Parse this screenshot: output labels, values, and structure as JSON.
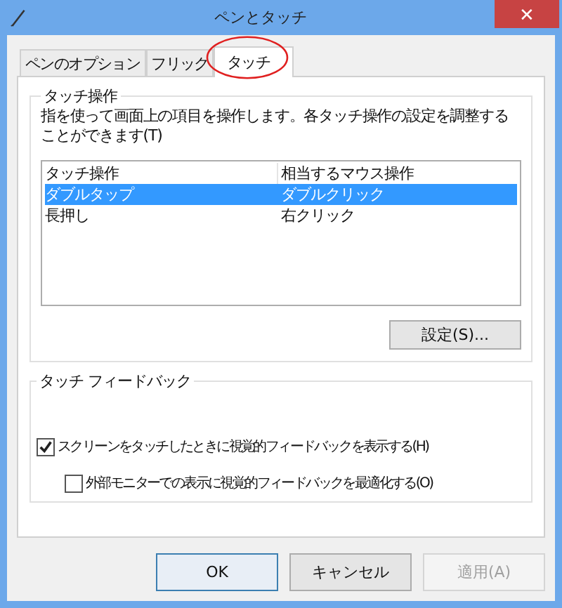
{
  "window": {
    "title": "ペンとタッチ",
    "close": "✕"
  },
  "tabs": [
    {
      "label": "ペンのオプション",
      "selected": false,
      "circled": false
    },
    {
      "label": "フリック",
      "selected": false,
      "circled": false
    },
    {
      "label": "タッチ",
      "selected": true,
      "circled": true
    }
  ],
  "touch_actions": {
    "title": "タッチ操作",
    "description": "指を使って画面上の項目を操作します。各タッチ操作の設定を調整することができます(T)",
    "columns": [
      "タッチ操作",
      "相当するマウス操作"
    ],
    "rows": [
      {
        "cells": [
          "ダブルタップ",
          "ダブルクリック"
        ],
        "selected": true
      },
      {
        "cells": [
          "長押し",
          "右クリック"
        ],
        "selected": false
      }
    ],
    "settings_button": "設定(S)..."
  },
  "touch_feedback": {
    "title": "タッチ フィードバック",
    "options": [
      {
        "label": "スクリーンをタッチしたときに視覚的フィードバックを表示する(H)",
        "checked": true,
        "children": [
          {
            "label": "外部モニターでの表示に視覚的フィードバックを最適化する(O)",
            "checked": false
          }
        ]
      }
    ]
  },
  "buttons": [
    {
      "label": "OK",
      "default": true,
      "disabled": false
    },
    {
      "label": "キャンセル",
      "default": false,
      "disabled": false
    },
    {
      "label": "適用(A)",
      "default": false,
      "disabled": true
    }
  ]
}
